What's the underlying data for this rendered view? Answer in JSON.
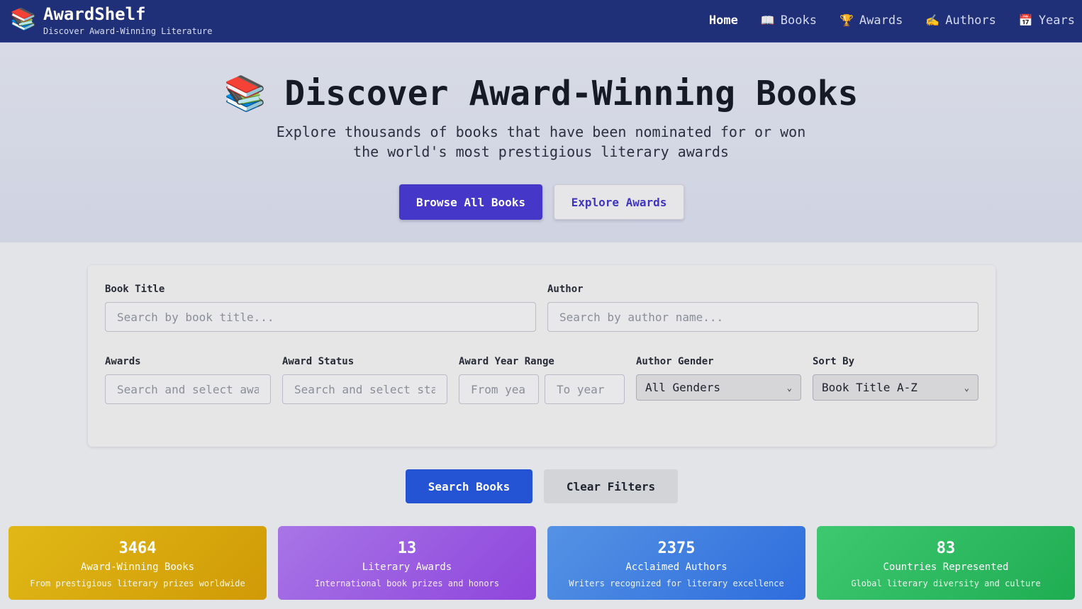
{
  "header": {
    "brand_icon": "books-icon",
    "brand_name": "AwardShelf",
    "tagline": "Discover Award-Winning Literature",
    "nav": [
      {
        "label": "Home",
        "icon": "",
        "active": true
      },
      {
        "label": "Books",
        "icon": "📖",
        "icon_name": "open-book-icon"
      },
      {
        "label": "Awards",
        "icon": "🏆",
        "icon_name": "trophy-icon"
      },
      {
        "label": "Authors",
        "icon": "✍️",
        "icon_name": "writing-hand-icon"
      },
      {
        "label": "Years",
        "icon": "📅",
        "icon_name": "calendar-icon"
      }
    ]
  },
  "hero": {
    "icon": "📚",
    "title": "Discover Award-Winning Books",
    "subtitle": "Explore thousands of books that have been nominated for or won the world's most prestigious literary awards",
    "primary_button": "Browse All Books",
    "secondary_button": "Explore Awards"
  },
  "filters": {
    "title_label": "Book Title",
    "title_placeholder": "Search by book title...",
    "author_label": "Author",
    "author_placeholder": "Search by author name...",
    "awards_label": "Awards",
    "awards_placeholder": "Search and select awards...",
    "status_label": "Award Status",
    "status_placeholder": "Search and select status...",
    "year_label": "Award Year Range",
    "year_from_placeholder": "From year",
    "year_to_placeholder": "To year",
    "gender_label": "Author Gender",
    "gender_value": "All Genders",
    "sort_label": "Sort By",
    "sort_value": "Book Title A-Z"
  },
  "actions": {
    "search": "Search Books",
    "clear": "Clear Filters"
  },
  "stats": [
    {
      "value": "3464",
      "label": "Award-Winning Books",
      "desc": "From prestigious literary prizes worldwide",
      "color_from": "#e0b816",
      "color_to": "#d09a06"
    },
    {
      "value": "13",
      "label": "Literary Awards",
      "desc": "International book prizes and honors",
      "color_from": "#a875e6",
      "color_to": "#8e45dc"
    },
    {
      "value": "2375",
      "label": "Acclaimed Authors",
      "desc": "Writers recognized for literary excellence",
      "color_from": "#5592e4",
      "color_to": "#2e6ddd"
    },
    {
      "value": "83",
      "label": "Countries Represented",
      "desc": "Global literary diversity and culture",
      "color_from": "#3ec870",
      "color_to": "#1fad52"
    }
  ],
  "colors": {
    "header_bg": "#1f2f78",
    "primary": "#4538c8",
    "search_button": "#2453d4"
  }
}
